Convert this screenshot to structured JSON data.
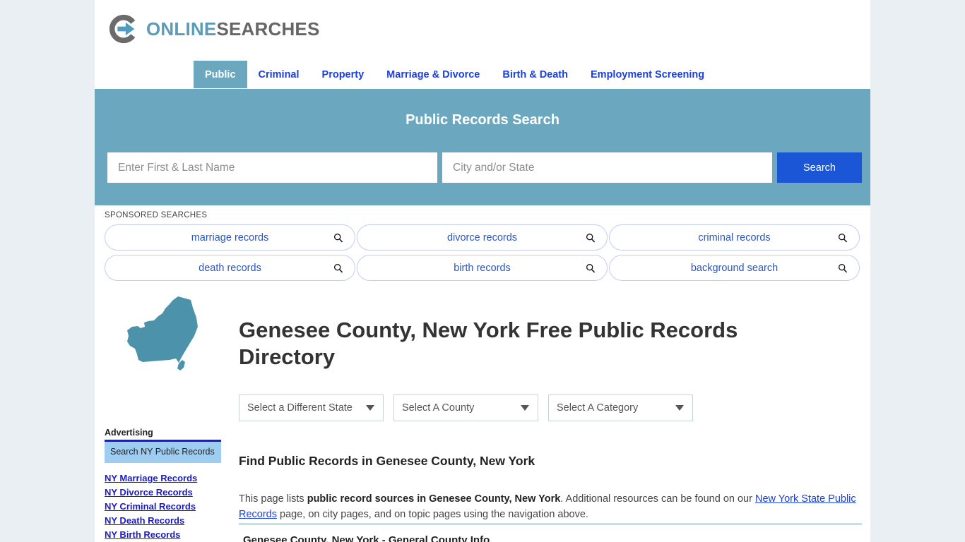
{
  "site": {
    "logo_online": "ONLINE",
    "logo_searches": "SEARCHES",
    "logo_icon": "circle-arrow-icon"
  },
  "nav": {
    "items": [
      {
        "label": "Public",
        "active": true
      },
      {
        "label": "Criminal",
        "active": false
      },
      {
        "label": "Property",
        "active": false
      },
      {
        "label": "Marriage & Divorce",
        "active": false
      },
      {
        "label": "Birth & Death",
        "active": false
      },
      {
        "label": "Employment Screening",
        "active": false
      }
    ]
  },
  "hero": {
    "title": "Public Records Search",
    "name_placeholder": "Enter First & Last Name",
    "name_value": "",
    "location_placeholder": "City and/or State",
    "location_value": "",
    "search_button": "Search",
    "background_color": "#6ba8c0",
    "button_color": "#1a56d6"
  },
  "sponsored": {
    "label": "SPONSORED SEARCHES",
    "pills": [
      {
        "label": "marriage records",
        "icon": "search-icon"
      },
      {
        "label": "divorce records",
        "icon": "search-icon"
      },
      {
        "label": "criminal records",
        "icon": "search-icon"
      },
      {
        "label": "death records",
        "icon": "search-icon"
      },
      {
        "label": "birth records",
        "icon": "search-icon"
      },
      {
        "label": "background search",
        "icon": "search-icon"
      }
    ]
  },
  "page": {
    "title": "Genesee County, New York Free Public Records Directory",
    "map_icon": "new-york-state-map-icon",
    "map_color": "#4d92ab"
  },
  "selects": {
    "state": "Select a Different State",
    "county": "Select A County",
    "category": "Select A Category"
  },
  "sidebar": {
    "ad_heading": "Advertising",
    "ad_box_text": "Search NY Public Records",
    "links": [
      "NY Marriage Records",
      "NY Divorce Records",
      "NY Criminal Records",
      "NY Death Records",
      "NY Birth Records"
    ]
  },
  "main": {
    "section_heading": "Find Public Records in Genesee County, New York",
    "para_lead": "This page lists ",
    "para_bold": "public record sources in Genesee County, New York",
    "para_mid": ". Additional resources can be found on our ",
    "para_link": "New York State Public Records",
    "para_tail": " page, on city pages, and on topic pages using the navigation above.",
    "table_caption": "Genesee County, New York - General County Info"
  }
}
